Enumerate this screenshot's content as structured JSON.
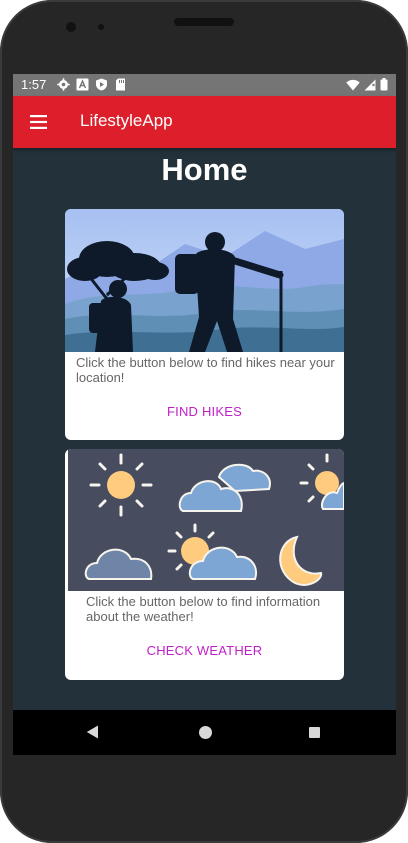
{
  "status_bar": {
    "time": "1:57",
    "icons": [
      "settings-icon",
      "a-icon",
      "play-protect-icon",
      "sd-card-icon"
    ],
    "right_icons": [
      "wifi-icon",
      "signal-icon",
      "battery-icon"
    ]
  },
  "app_bar": {
    "title": "LifestyleApp",
    "menu_icon": "hamburger-menu-icon",
    "color": "#dc1f2b"
  },
  "page": {
    "title": "Home",
    "background": "#22313a"
  },
  "cards": [
    {
      "image": "hikers-silhouette-illustration",
      "text": "Click the button below to find hikes near your location!",
      "button_label": "FIND HIKES"
    },
    {
      "image": "weather-icons-illustration",
      "text": "Click the button below to find information about the weather!",
      "button_label": "CHECK WEATHER"
    }
  ],
  "accent_color": "#c020c8",
  "nav_bar": {
    "buttons": [
      "back-icon",
      "home-icon",
      "recents-icon"
    ]
  }
}
